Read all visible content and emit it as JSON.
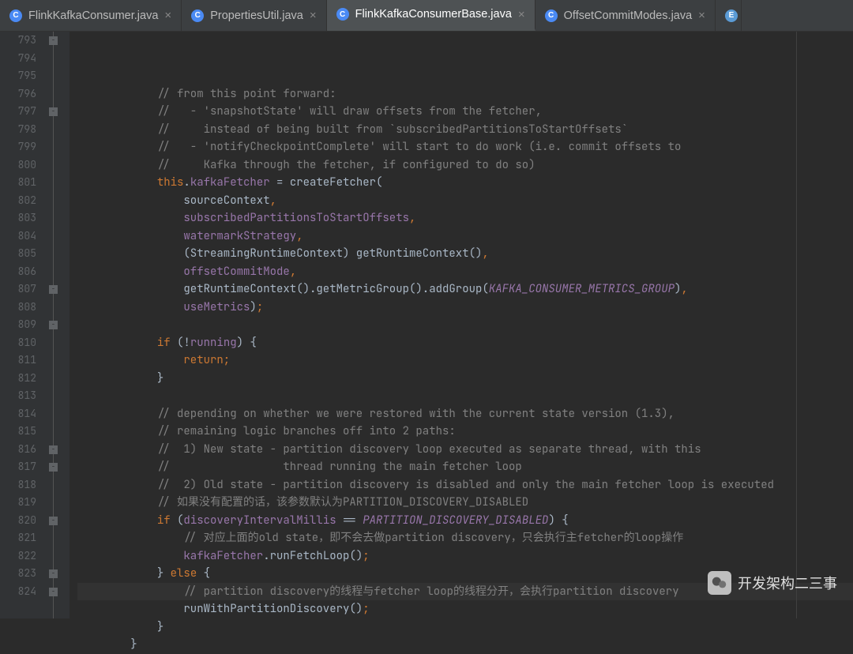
{
  "tabs": [
    {
      "label": "FlinkKafkaConsumer.java",
      "active": false
    },
    {
      "label": "PropertiesUtil.java",
      "active": false
    },
    {
      "label": "FlinkKafkaConsumerBase.java",
      "active": true
    },
    {
      "label": "OffsetCommitModes.java",
      "active": false
    }
  ],
  "extra_tab_icon": "E",
  "line_start": 793,
  "line_end": 824,
  "highlighted_line": 821,
  "fold_markers": [
    793,
    797,
    807,
    809,
    816,
    817,
    820,
    823,
    824
  ],
  "code_lines": [
    {
      "n": 793,
      "indent": 3,
      "tokens": [
        {
          "c": "cmt",
          "t": "// from this point forward:"
        }
      ]
    },
    {
      "n": 794,
      "indent": 3,
      "tokens": [
        {
          "c": "cmt",
          "t": "//   - 'snapshotState' will draw offsets from the fetcher,"
        }
      ]
    },
    {
      "n": 795,
      "indent": 3,
      "tokens": [
        {
          "c": "cmt",
          "t": "//     instead of being built from `subscribedPartitionsToStartOffsets`"
        }
      ]
    },
    {
      "n": 796,
      "indent": 3,
      "tokens": [
        {
          "c": "cmt",
          "t": "//   - 'notifyCheckpointComplete' will start to do work (i.e. commit offsets to"
        }
      ]
    },
    {
      "n": 797,
      "indent": 3,
      "tokens": [
        {
          "c": "cmt",
          "t": "//     Kafka through the fetcher, if configured to do so)"
        }
      ]
    },
    {
      "n": 798,
      "indent": 3,
      "tokens": [
        {
          "c": "this",
          "t": "this"
        },
        {
          "c": "ident",
          "t": "."
        },
        {
          "c": "field",
          "t": "kafkaFetcher"
        },
        {
          "c": "ident",
          "t": " = createFetcher("
        }
      ]
    },
    {
      "n": 799,
      "indent": 4,
      "tokens": [
        {
          "c": "ident",
          "t": "sourceContext"
        },
        {
          "c": "kw",
          "t": ","
        }
      ]
    },
    {
      "n": 800,
      "indent": 4,
      "tokens": [
        {
          "c": "field",
          "t": "subscribedPartitionsToStartOffsets"
        },
        {
          "c": "kw",
          "t": ","
        }
      ]
    },
    {
      "n": 801,
      "indent": 4,
      "tokens": [
        {
          "c": "field",
          "t": "watermarkStrategy"
        },
        {
          "c": "kw",
          "t": ","
        }
      ]
    },
    {
      "n": 802,
      "indent": 4,
      "tokens": [
        {
          "c": "ident",
          "t": "(StreamingRuntimeContext) getRuntimeContext()"
        },
        {
          "c": "kw",
          "t": ","
        }
      ]
    },
    {
      "n": 803,
      "indent": 4,
      "tokens": [
        {
          "c": "field",
          "t": "offsetCommitMode"
        },
        {
          "c": "kw",
          "t": ","
        }
      ]
    },
    {
      "n": 804,
      "indent": 4,
      "tokens": [
        {
          "c": "ident",
          "t": "getRuntimeContext().getMetricGroup().addGroup("
        },
        {
          "c": "const",
          "t": "KAFKA_CONSUMER_METRICS_GROUP"
        },
        {
          "c": "ident",
          "t": ")"
        },
        {
          "c": "kw",
          "t": ","
        }
      ]
    },
    {
      "n": 805,
      "indent": 4,
      "tokens": [
        {
          "c": "field",
          "t": "useMetrics"
        },
        {
          "c": "ident",
          "t": ")"
        },
        {
          "c": "kw",
          "t": ";"
        }
      ]
    },
    {
      "n": 806,
      "indent": 0,
      "tokens": []
    },
    {
      "n": 807,
      "indent": 3,
      "tokens": [
        {
          "c": "kw",
          "t": "if "
        },
        {
          "c": "ident",
          "t": "(!"
        },
        {
          "c": "field",
          "t": "running"
        },
        {
          "c": "ident",
          "t": ") {"
        }
      ]
    },
    {
      "n": 808,
      "indent": 4,
      "tokens": [
        {
          "c": "kw",
          "t": "return;"
        }
      ]
    },
    {
      "n": 809,
      "indent": 3,
      "tokens": [
        {
          "c": "ident",
          "t": "}"
        }
      ]
    },
    {
      "n": 810,
      "indent": 0,
      "tokens": []
    },
    {
      "n": 811,
      "indent": 3,
      "tokens": [
        {
          "c": "cmt",
          "t": "// depending on whether we were restored with the current state version (1.3),"
        }
      ]
    },
    {
      "n": 812,
      "indent": 3,
      "tokens": [
        {
          "c": "cmt",
          "t": "// remaining logic branches off into 2 paths:"
        }
      ]
    },
    {
      "n": 813,
      "indent": 3,
      "tokens": [
        {
          "c": "cmt",
          "t": "//  1) New state - partition discovery loop executed as separate thread, with this"
        }
      ]
    },
    {
      "n": 814,
      "indent": 3,
      "tokens": [
        {
          "c": "cmt",
          "t": "//                 thread running the main fetcher loop"
        }
      ]
    },
    {
      "n": 815,
      "indent": 3,
      "tokens": [
        {
          "c": "cmt",
          "t": "//  2) Old state - partition discovery is disabled and only the main fetcher loop is executed"
        }
      ]
    },
    {
      "n": 816,
      "indent": 3,
      "tokens": [
        {
          "c": "cmt",
          "t": "// 如果没有配置的话，该参数默认为PARTITION_DISCOVERY_DISABLED"
        }
      ]
    },
    {
      "n": 817,
      "indent": 3,
      "tokens": [
        {
          "c": "kw",
          "t": "if "
        },
        {
          "c": "ident",
          "t": "("
        },
        {
          "c": "field",
          "t": "discoveryIntervalMillis"
        },
        {
          "c": "ident",
          "t": " == "
        },
        {
          "c": "const",
          "t": "PARTITION_DISCOVERY_DISABLED"
        },
        {
          "c": "ident",
          "t": ") {"
        }
      ]
    },
    {
      "n": 818,
      "indent": 4,
      "tokens": [
        {
          "c": "cmt",
          "t": "// 对应上面的old state，即不会去做partition discovery，只会执行主fetcher的loop操作"
        }
      ]
    },
    {
      "n": 819,
      "indent": 4,
      "tokens": [
        {
          "c": "field",
          "t": "kafkaFetcher"
        },
        {
          "c": "ident",
          "t": ".runFetchLoop()"
        },
        {
          "c": "kw",
          "t": ";"
        }
      ]
    },
    {
      "n": 820,
      "indent": 3,
      "tokens": [
        {
          "c": "ident",
          "t": "} "
        },
        {
          "c": "kw",
          "t": "else "
        },
        {
          "c": "ident",
          "t": "{"
        }
      ]
    },
    {
      "n": 821,
      "indent": 4,
      "tokens": [
        {
          "c": "cmt",
          "t": "// partition discovery的线程与fetcher loop的线程分开，会执行partition discovery"
        }
      ]
    },
    {
      "n": 822,
      "indent": 4,
      "tokens": [
        {
          "c": "ident",
          "t": "runWithPartitionDiscovery()"
        },
        {
          "c": "kw",
          "t": ";"
        }
      ]
    },
    {
      "n": 823,
      "indent": 3,
      "tokens": [
        {
          "c": "ident",
          "t": "}"
        }
      ]
    },
    {
      "n": 824,
      "indent": 2,
      "tokens": [
        {
          "c": "ident",
          "t": "}"
        }
      ]
    }
  ],
  "watermark": "开发架构二三事"
}
